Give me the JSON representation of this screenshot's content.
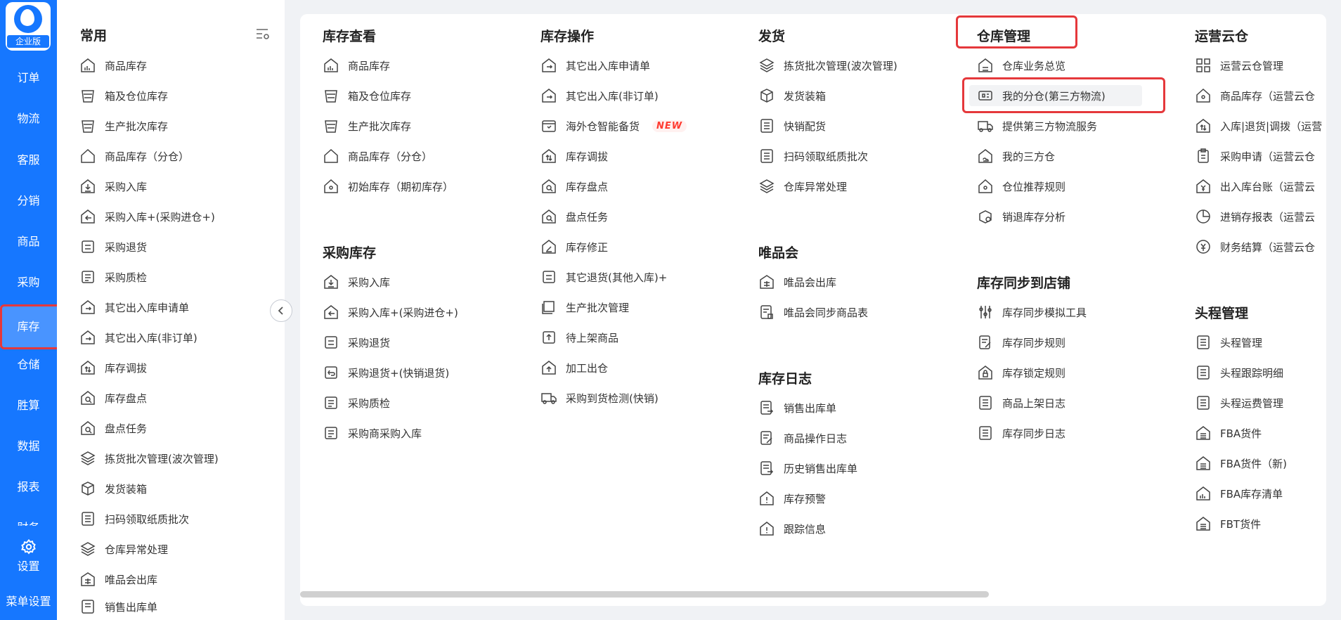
{
  "logo": {
    "badge": "企业版"
  },
  "nav": {
    "items": [
      "订单",
      "物流",
      "客服",
      "分销",
      "商品",
      "采购",
      "库存",
      "仓储",
      "胜算",
      "数据",
      "报表",
      "财务"
    ],
    "active_index": 6,
    "settings": "设置",
    "menu_settings": "菜单设置"
  },
  "common": {
    "title": "常用",
    "items": [
      "商品库存",
      "箱及仓位库存",
      "生产批次库存",
      "商品库存（分仓）",
      "采购入库",
      "采购入库+(采购进仓+)",
      "采购退货",
      "采购质检",
      "其它出入库申请单",
      "其它出入库(非订单)",
      "库存调拔",
      "库存盘点",
      "盘点任务",
      "拣货批次管理(波次管理)",
      "发货装箱",
      "扫码领取纸质批次",
      "仓库异常处理",
      "唯品会出库",
      "销售出库单"
    ]
  },
  "sections": {
    "kucun_chakan": {
      "title": "库存查看",
      "items": [
        "商品库存",
        "箱及仓位库存",
        "生产批次库存",
        "商品库存（分仓）",
        "初始库存（期初库存）"
      ]
    },
    "caigou_kucun": {
      "title": "采购库存",
      "items": [
        "采购入库",
        "采购入库+(采购进仓+)",
        "采购退货",
        "采购退货+(快销退货)",
        "采购质检",
        "采购商采购入库"
      ]
    },
    "kucun_caozuo": {
      "title": "库存操作",
      "items": [
        "其它出入库申请单",
        "其它出入库(非订单)",
        "海外仓智能备货",
        "库存调拔",
        "库存盘点",
        "盘点任务",
        "库存修正",
        "其它退货(其他入库)+",
        "生产批次管理",
        "待上架商品",
        "加工出仓",
        "采购到货检测(快销)"
      ],
      "new_badge": "NEW"
    },
    "fahuo": {
      "title": "发货",
      "items": [
        "拣货批次管理(波次管理)",
        "发货装箱",
        "快销配货",
        "扫码领取纸质批次",
        "仓库异常处理"
      ]
    },
    "weipinhui": {
      "title": "唯品会",
      "items": [
        "唯品会出库",
        "唯品会同步商品表"
      ]
    },
    "kucun_rizhi": {
      "title": "库存日志",
      "items": [
        "销售出库单",
        "商品操作日志",
        "历史销售出库单",
        "库存预警",
        "跟踪信息"
      ]
    },
    "cangku_guanli": {
      "title": "仓库管理",
      "items": [
        "仓库业务总览",
        "我的分仓(第三方物流)",
        "提供第三方物流服务",
        "我的三方仓",
        "仓位推荐规则",
        "销退库存分析"
      ]
    },
    "kucun_tongbu": {
      "title": "库存同步到店铺",
      "items": [
        "库存同步模拟工具",
        "库存同步规则",
        "库存锁定规则",
        "商品上架日志",
        "库存同步日志"
      ]
    },
    "yunying_yuncang": {
      "title": "运营云仓",
      "items": [
        "运营云仓管理",
        "商品库存（运营云仓",
        "入库|退货|调拨（运营",
        "采购申请（运营云仓",
        "出入库台账（运营云",
        "进销存报表（运营云",
        "财务结算（运营云仓"
      ]
    },
    "toucheng": {
      "title": "头程管理",
      "items": [
        "头程管理",
        "头程跟踪明细",
        "头程运费管理",
        "FBA货件",
        "FBA货件（新)",
        "FBA库存清单",
        "FBT货件"
      ]
    }
  }
}
